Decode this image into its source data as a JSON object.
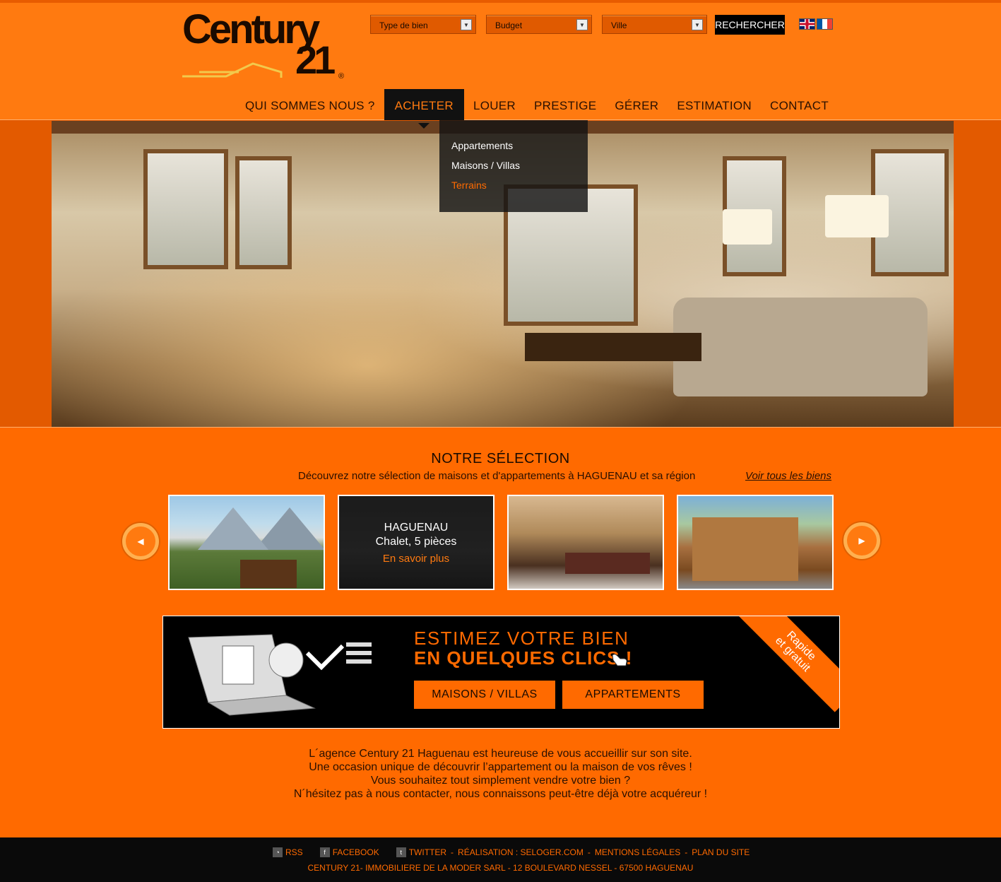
{
  "header": {
    "logo_word": "Century",
    "logo_number": "21",
    "logo_registered": "®",
    "search": {
      "type_placeholder": "Type de bien",
      "budget_placeholder": "Budget",
      "city_placeholder": "Ville",
      "button_label": "RECHERCHER"
    },
    "languages": [
      "English",
      "Français"
    ]
  },
  "nav": {
    "items": [
      {
        "label": "QUI SOMMES NOUS ?"
      },
      {
        "label": "ACHETER"
      },
      {
        "label": "LOUER"
      },
      {
        "label": "PRESTIGE"
      },
      {
        "label": "GÉRER"
      },
      {
        "label": "ESTIMATION"
      },
      {
        "label": "CONTACT"
      }
    ],
    "active": "ACHETER",
    "dropdown": [
      "Appartements",
      "Maisons / Villas",
      "Terrains"
    ]
  },
  "selection": {
    "title": "NOTRE SÉLECTION",
    "subtitle": "Découvrez notre sélection de maisons et d'appartements à HAGUENAU et sa région",
    "see_all": "Voir tous les biens",
    "featured": {
      "city": "HAGUENAU",
      "type": "Chalet, 5 pièces",
      "more": "En savoir plus"
    }
  },
  "estimate": {
    "line1": "ESTIMEZ VOTRE BIEN",
    "line2": "EN QUELQUES CLICS !",
    "button_houses": "MAISONS / VILLAS",
    "button_apartments": "APPARTEMENTS",
    "ribbon_line1": "Rapide",
    "ribbon_line2": "et gratuit"
  },
  "intro": {
    "line1": "L´agence Century 21 Haguenau est heureuse de vous accueillir sur son site.",
    "line2": "Une occasion unique de découvrir l’appartement ou la maison de vos rêves !",
    "line3": "Vous souhaitez tout simplement vendre votre bien ?",
    "line4": "N´hésitez pas à nous contacter, nous connaissons peut-être déjà votre acquéreur !"
  },
  "footer": {
    "rss": "RSS",
    "facebook": "FACEBOOK",
    "twitter": "TWITTER",
    "realisation": "RÉALISATION : SELOGER.COM",
    "legal": "MENTIONS LÉGALES",
    "sitemap": "PLAN DU SITE",
    "address": "CENTURY 21- IMMOBILIERE DE LA MODER SARL - 12 BOULEVARD NESSEL - 67500 HAGUENAU"
  },
  "colors": {
    "accent": "#ff6a00",
    "dark": "#000000"
  }
}
